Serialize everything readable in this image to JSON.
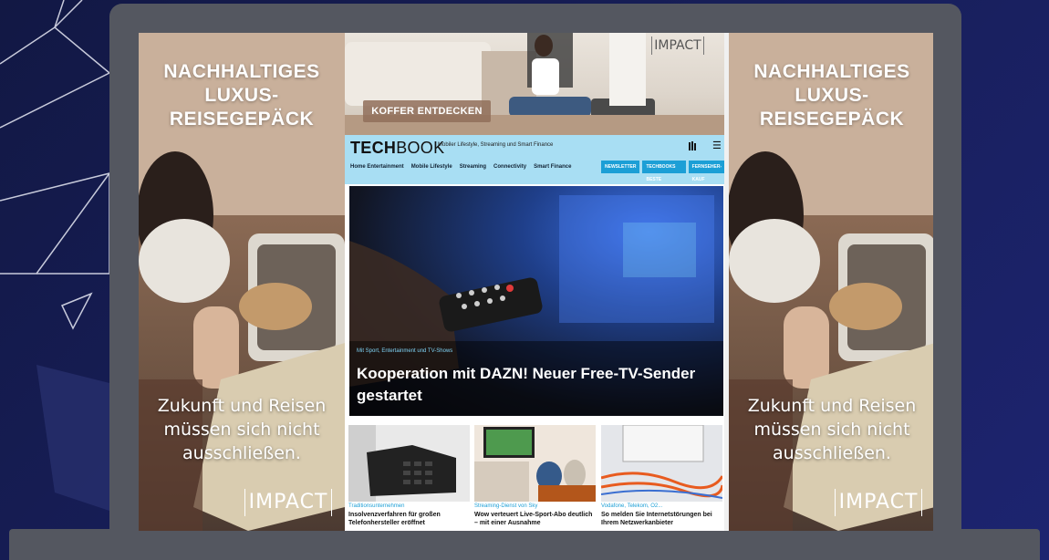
{
  "colors": {
    "background": "#141a4c",
    "laptop": "#545760",
    "techbook_header": "#a8def3",
    "accent": "#1c9fd6"
  },
  "side_ad": {
    "headline": "NACHHALTIGES\nLUXUS-\nREISEGEPÄCK",
    "tagline": "Zukunft und Reisen\nmüssen sich nicht\nausschließen.",
    "logo": "IMPACT"
  },
  "top_banner": {
    "button_label": "KOFFER ENTDECKEN",
    "logo": "IMPACT"
  },
  "header": {
    "logo_tech": "TECH",
    "logo_book": "BOOK",
    "tagline": "Mobiler Lifestyle, Streaming und Smart Finance",
    "menu_icon": "☰",
    "nav": [
      "Home Entertainment",
      "Mobile Lifestyle",
      "Streaming",
      "Connectivity",
      "Smart Finance"
    ],
    "pills": [
      "NEWSLETTER",
      "TECHBOOKS BESTE",
      "FERNSEHER-KAUF"
    ]
  },
  "hero": {
    "kicker": "Mit Sport, Entertainment und TV-Shows",
    "title": "Kooperation mit DAZN! Neuer Free-TV-Sender gestartet"
  },
  "teasers": [
    {
      "kicker": "Traditionsunternehmen",
      "title": "Insolvenzverfahren für großen Telefonhersteller eröffnet"
    },
    {
      "kicker": "Streaming-Dienst von Sky",
      "title": "Wow verteuert Live-Sport-Abo deutlich – mit einer Ausnahme"
    },
    {
      "kicker": "Vodafone, Telekom, O2...",
      "title": "So melden Sie Internetstörungen bei Ihrem Netzwerkanbieter"
    }
  ]
}
